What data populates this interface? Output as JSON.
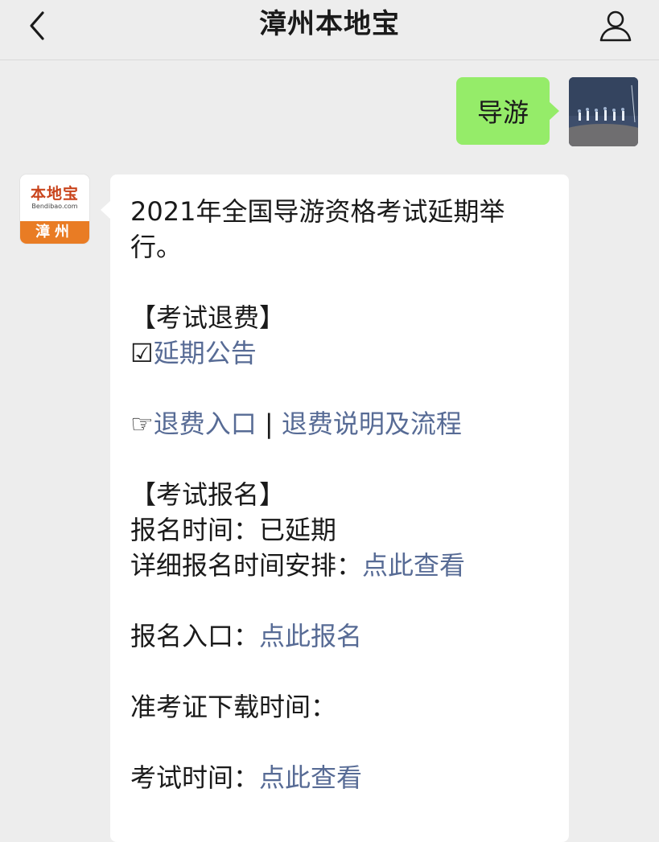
{
  "nav": {
    "title": "漳州本地宝"
  },
  "outgoing": {
    "text": "导游"
  },
  "bot_avatar": {
    "brand": "本地宝",
    "site": "Bendibao.com",
    "city": "漳州"
  },
  "message": {
    "headline": "2021年全国导游资格考试延期举行。",
    "refund_section": "【考试退费】",
    "postpone_prefix": "☑",
    "postpone_link": "延期公告",
    "refund_prefix": "☞",
    "refund_entry_link": "退费入口",
    "refund_separator": " | ",
    "refund_guide_link": "退费说明及流程",
    "signup_section": "【考试报名】",
    "signup_time_label": "报名时间：",
    "signup_time_value": "已延期",
    "schedule_label": "详细报名时间安排：",
    "schedule_link": "点此查看",
    "entry_label": "报名入口：",
    "entry_link": "点此报名",
    "admission_label": "准考证下载时间：",
    "exam_time_label": "考试时间：",
    "exam_time_link": "点此查看"
  },
  "colors": {
    "link": "#576b95",
    "outgoing_bubble": "#95ec69",
    "background": "#ededed",
    "brand": "#c9441c",
    "city_badge": "#e97c24"
  }
}
